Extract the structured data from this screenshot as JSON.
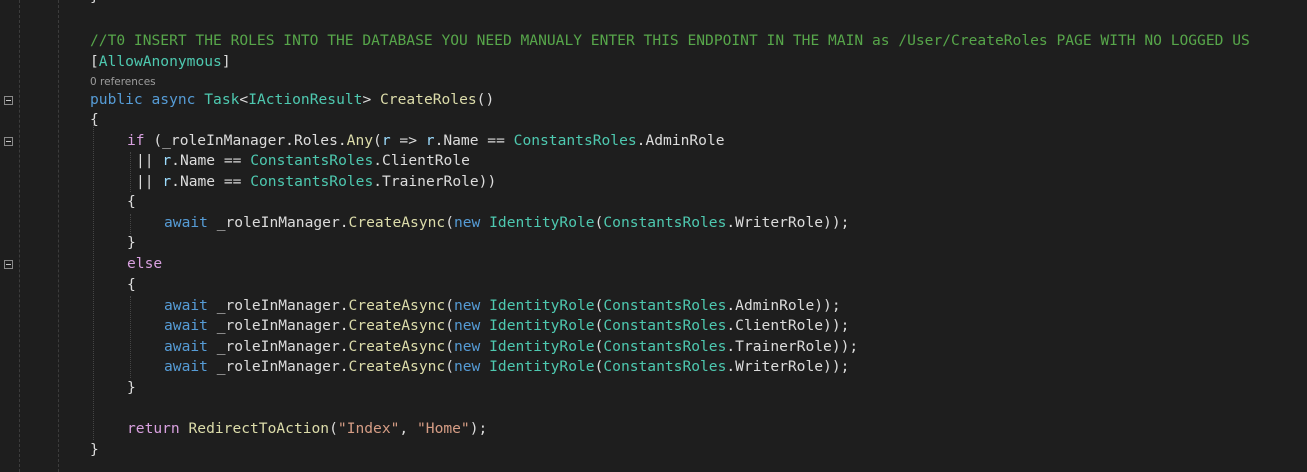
{
  "code": {
    "lines": [
      {
        "tokens": [
          {
            "t": "}",
            "c": "punc"
          }
        ]
      },
      {
        "tokens": []
      },
      {
        "tokens": [
          {
            "t": "//T0 INSERT THE ROLES INTO THE DATABASE YOU NEED MANUALY ENTER THIS ENDPOINT IN THE MAIN as /User/CreateRoles PAGE WITH NO LOGGED US",
            "c": "cm"
          }
        ]
      },
      {
        "tokens": [
          {
            "t": "[",
            "c": "punc"
          },
          {
            "t": "AllowAnonymous",
            "c": "ty"
          },
          {
            "t": "]",
            "c": "punc"
          }
        ]
      },
      {
        "lens": "0 references"
      },
      {
        "tokens": [
          {
            "t": "public",
            "c": "kw"
          },
          {
            "t": " ",
            "c": "punc"
          },
          {
            "t": "async",
            "c": "kw"
          },
          {
            "t": " ",
            "c": "punc"
          },
          {
            "t": "Task",
            "c": "ty"
          },
          {
            "t": "<",
            "c": "punc"
          },
          {
            "t": "IActionResult",
            "c": "ty"
          },
          {
            "t": "> ",
            "c": "punc"
          },
          {
            "t": "CreateRoles",
            "c": "fn"
          },
          {
            "t": "()",
            "c": "punc"
          }
        ]
      },
      {
        "tokens": [
          {
            "t": "{",
            "c": "punc"
          }
        ]
      },
      {
        "tokens": [
          {
            "t": "if",
            "c": "ctl"
          },
          {
            "t": " (_roleInManager.Roles.",
            "c": "punc"
          },
          {
            "t": "Any",
            "c": "fn"
          },
          {
            "t": "(",
            "c": "punc"
          },
          {
            "t": "r",
            "c": "param"
          },
          {
            "t": " => ",
            "c": "punc"
          },
          {
            "t": "r",
            "c": "param"
          },
          {
            "t": ".Name == ",
            "c": "punc"
          },
          {
            "t": "ConstantsRoles",
            "c": "ty"
          },
          {
            "t": ".AdminRole",
            "c": "punc"
          }
        ]
      },
      {
        "tokens": [
          {
            "t": "|| ",
            "c": "punc"
          },
          {
            "t": "r",
            "c": "param"
          },
          {
            "t": ".Name == ",
            "c": "punc"
          },
          {
            "t": "ConstantsRoles",
            "c": "ty"
          },
          {
            "t": ".ClientRole",
            "c": "punc"
          }
        ]
      },
      {
        "tokens": [
          {
            "t": "|| ",
            "c": "punc"
          },
          {
            "t": "r",
            "c": "param"
          },
          {
            "t": ".Name == ",
            "c": "punc"
          },
          {
            "t": "ConstantsRoles",
            "c": "ty"
          },
          {
            "t": ".TrainerRole))",
            "c": "punc"
          }
        ]
      },
      {
        "tokens": [
          {
            "t": "{",
            "c": "punc"
          }
        ]
      },
      {
        "tokens": [
          {
            "t": "await",
            "c": "kw"
          },
          {
            "t": " _roleInManager.",
            "c": "punc"
          },
          {
            "t": "CreateAsync",
            "c": "fn"
          },
          {
            "t": "(",
            "c": "punc"
          },
          {
            "t": "new",
            "c": "kw"
          },
          {
            "t": " ",
            "c": "punc"
          },
          {
            "t": "IdentityRole",
            "c": "ty"
          },
          {
            "t": "(",
            "c": "punc"
          },
          {
            "t": "ConstantsRoles",
            "c": "ty"
          },
          {
            "t": ".WriterRole));",
            "c": "punc"
          }
        ]
      },
      {
        "tokens": [
          {
            "t": "}",
            "c": "punc"
          }
        ]
      },
      {
        "tokens": [
          {
            "t": "else",
            "c": "ctl"
          }
        ]
      },
      {
        "tokens": [
          {
            "t": "{",
            "c": "punc"
          }
        ]
      },
      {
        "tokens": [
          {
            "t": "await",
            "c": "kw"
          },
          {
            "t": " _roleInManager.",
            "c": "punc"
          },
          {
            "t": "CreateAsync",
            "c": "fn"
          },
          {
            "t": "(",
            "c": "punc"
          },
          {
            "t": "new",
            "c": "kw"
          },
          {
            "t": " ",
            "c": "punc"
          },
          {
            "t": "IdentityRole",
            "c": "ty"
          },
          {
            "t": "(",
            "c": "punc"
          },
          {
            "t": "ConstantsRoles",
            "c": "ty"
          },
          {
            "t": ".AdminRole));",
            "c": "punc"
          }
        ]
      },
      {
        "tokens": [
          {
            "t": "await",
            "c": "kw"
          },
          {
            "t": " _roleInManager.",
            "c": "punc"
          },
          {
            "t": "CreateAsync",
            "c": "fn"
          },
          {
            "t": "(",
            "c": "punc"
          },
          {
            "t": "new",
            "c": "kw"
          },
          {
            "t": " ",
            "c": "punc"
          },
          {
            "t": "IdentityRole",
            "c": "ty"
          },
          {
            "t": "(",
            "c": "punc"
          },
          {
            "t": "ConstantsRoles",
            "c": "ty"
          },
          {
            "t": ".ClientRole));",
            "c": "punc"
          }
        ]
      },
      {
        "tokens": [
          {
            "t": "await",
            "c": "kw"
          },
          {
            "t": " _roleInManager.",
            "c": "punc"
          },
          {
            "t": "CreateAsync",
            "c": "fn"
          },
          {
            "t": "(",
            "c": "punc"
          },
          {
            "t": "new",
            "c": "kw"
          },
          {
            "t": " ",
            "c": "punc"
          },
          {
            "t": "IdentityRole",
            "c": "ty"
          },
          {
            "t": "(",
            "c": "punc"
          },
          {
            "t": "ConstantsRoles",
            "c": "ty"
          },
          {
            "t": ".TrainerRole));",
            "c": "punc"
          }
        ]
      },
      {
        "tokens": [
          {
            "t": "await",
            "c": "kw"
          },
          {
            "t": " _roleInManager.",
            "c": "punc"
          },
          {
            "t": "CreateAsync",
            "c": "fn"
          },
          {
            "t": "(",
            "c": "punc"
          },
          {
            "t": "new",
            "c": "kw"
          },
          {
            "t": " ",
            "c": "punc"
          },
          {
            "t": "IdentityRole",
            "c": "ty"
          },
          {
            "t": "(",
            "c": "punc"
          },
          {
            "t": "ConstantsRoles",
            "c": "ty"
          },
          {
            "t": ".WriterRole));",
            "c": "punc"
          }
        ]
      },
      {
        "tokens": [
          {
            "t": "}",
            "c": "punc"
          }
        ]
      },
      {
        "tokens": []
      },
      {
        "tokens": [
          {
            "t": "return",
            "c": "ctl"
          },
          {
            "t": " ",
            "c": "punc"
          },
          {
            "t": "RedirectToAction",
            "c": "fn"
          },
          {
            "t": "(",
            "c": "punc"
          },
          {
            "t": "\"Index\"",
            "c": "str"
          },
          {
            "t": ", ",
            "c": "punc"
          },
          {
            "t": "\"Home\"",
            "c": "str"
          },
          {
            "t": ");",
            "c": "punc"
          }
        ]
      },
      {
        "tokens": [
          {
            "t": "}",
            "c": "punc"
          }
        ]
      }
    ]
  },
  "theme": {
    "background": "#1e1e1e",
    "keyword": "#569cd6",
    "control": "#d8a0df",
    "type": "#4ec9b0",
    "method": "#dcdcaa",
    "string": "#d69d85",
    "comment": "#57a64a",
    "parameter": "#9cdcfe",
    "text": "#dcdcdc"
  },
  "icons": {
    "fold": "collapse-minus-icon"
  }
}
